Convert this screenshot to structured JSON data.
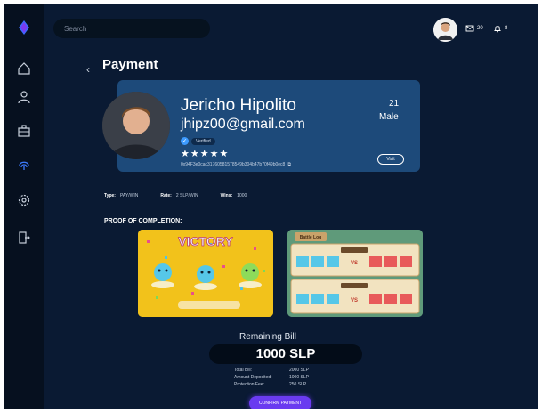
{
  "search": {
    "placeholder": "Search"
  },
  "topbar": {
    "mail_count": "20",
    "notification_count": "8"
  },
  "page": {
    "back_symbol": "‹",
    "title": "Payment"
  },
  "profile": {
    "name": "Jericho Hipolito",
    "email": "jhipz00@gmail.com",
    "verified_label": "Verified",
    "stars": "★★★★★",
    "wallet": "0x94F3e0cac31760581578549b304b47b70f49b0ec8",
    "age": "21",
    "gender": "Male",
    "visit_label": "Visit"
  },
  "info": {
    "type_label": "Type:",
    "type_value": "PAY/WIN",
    "rate_label": "Rate:",
    "rate_value": "2 SLP/WIN",
    "wins_label": "Wins:",
    "wins_value": "1000"
  },
  "proof": {
    "title": "PROOF OF COMPLETION:",
    "victory_text": "VICTORY",
    "battle_log_label": "Battle Log"
  },
  "bill": {
    "remaining_label": "Remaining Bill",
    "remaining_value": "1000 SLP",
    "rows": [
      {
        "label": "Total Bill:",
        "value": "2000 SLP"
      },
      {
        "label": "Amount Deposited:",
        "value": "1000 SLP"
      },
      {
        "label": "Protection Fee:",
        "value": "250 SLP"
      }
    ],
    "confirm_label": "CONFIRM PAYMENT"
  },
  "colors": {
    "background": "#0a1a33",
    "sidebar": "#06101f",
    "card": "#1d4a7a",
    "accent": "#6a3bf0",
    "active_icon": "#3d7bff"
  },
  "sidebar_icons": [
    "diamond-logo-icon",
    "home-icon",
    "user-icon",
    "briefcase-icon",
    "fingerprint-icon",
    "settings-icon",
    "logout-icon"
  ]
}
